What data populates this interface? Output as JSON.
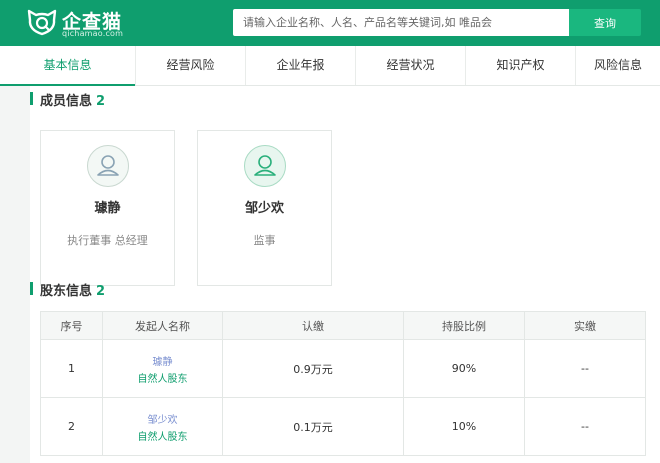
{
  "header": {
    "logo_text": "企查猫",
    "logo_sub": "qichamao.com",
    "search_placeholder": "请输入企业名称、人名、产品名等关键词,如 唯品会",
    "search_button": "查询",
    "brand_color": "#0f9e6e"
  },
  "tabs": [
    {
      "label": "基本信息",
      "active": true
    },
    {
      "label": "经营风险"
    },
    {
      "label": "企业年报"
    },
    {
      "label": "经营状况"
    },
    {
      "label": "知识产权"
    },
    {
      "label": "风险信息"
    }
  ],
  "members": {
    "title": "成员信息",
    "count": "2",
    "items": [
      {
        "name": "璩静",
        "role": "执行董事 总经理",
        "icon": "person-icon"
      },
      {
        "name": "邹少欢",
        "role": "监事",
        "icon": "person-icon"
      }
    ]
  },
  "shareholders": {
    "title": "股东信息",
    "count": "2",
    "columns": [
      "序号",
      "发起人名称",
      "认缴",
      "持股比例",
      "实缴"
    ],
    "rows": [
      {
        "index": "1",
        "name": "璩静",
        "type": "自然人股东",
        "subscribed": "0.9万元",
        "ratio": "90%",
        "paid": "--"
      },
      {
        "index": "2",
        "name": "邹少欢",
        "type": "自然人股东",
        "subscribed": "0.1万元",
        "ratio": "10%",
        "paid": "--"
      }
    ]
  }
}
